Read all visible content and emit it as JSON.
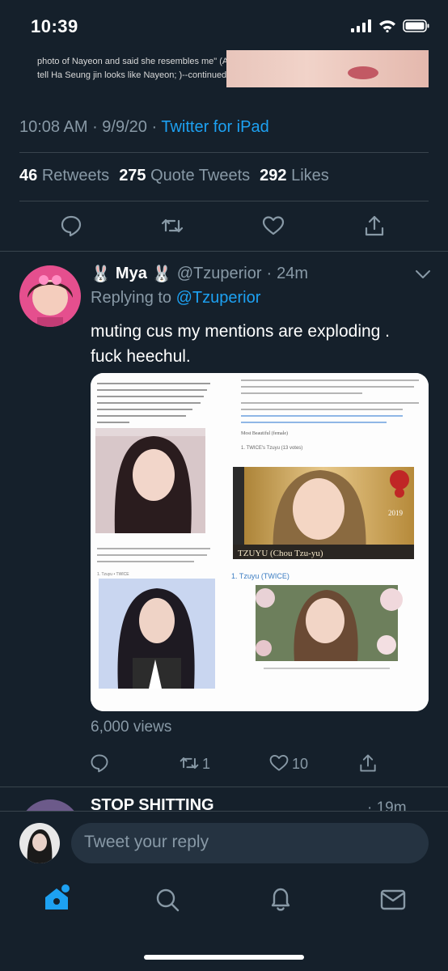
{
  "status": {
    "time": "10:39"
  },
  "quoted": {
    "line1": "photo of Nayeon and said she resembles me\" (A",
    "line2": "tell Ha Seung jin looks like Nayeon; )--continued"
  },
  "main_tweet": {
    "time": "10:08 AM",
    "date": "9/9/20",
    "source": "Twitter for iPad",
    "retweets_count": "46",
    "retweets_label": "Retweets",
    "quotes_count": "275",
    "quotes_label": "Quote Tweets",
    "likes_count": "292",
    "likes_label": "Likes"
  },
  "reply": {
    "display_name": "Mya",
    "name_emoji_left": "🐰",
    "name_emoji_right": "🐰",
    "handle": "@Tzuperior",
    "time": "24m",
    "replying_label": "Replying to",
    "replying_to": "@Tzuperior",
    "text": "muting cus my mentions are exploding . fuck heechul.",
    "views": "6,000 views",
    "retweet_count": "1",
    "like_count": "10",
    "media": {
      "caption_main": "TZUYU   (Chou Tzu-yu)",
      "section_title": "1. Tzuyu (TWICE)",
      "list_header": "Most Beautiful (female)",
      "list_item": "1. TWICE's Tzuyu (13 votes)",
      "year_badge": "2019",
      "small_label": "1. Tzuyu • TWICE"
    }
  },
  "next_tweet": {
    "name": "STOP SHITTING",
    "time": "19m"
  },
  "compose": {
    "placeholder": "Tweet your reply"
  },
  "colors": {
    "background": "#15202b",
    "accent": "#1da1f2",
    "muted": "#8899a6"
  }
}
